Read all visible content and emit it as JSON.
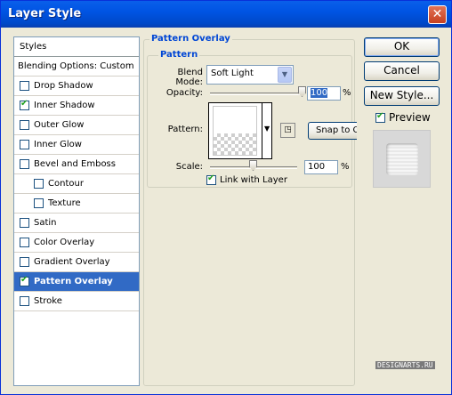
{
  "window": {
    "title": "Layer Style",
    "close_glyph": "✕"
  },
  "styles_list": {
    "header": "Styles",
    "blending_options": "Blending Options: Custom",
    "items": [
      {
        "label": "Drop Shadow",
        "checked": false,
        "indent": false,
        "selected": false
      },
      {
        "label": "Inner Shadow",
        "checked": true,
        "indent": false,
        "selected": false
      },
      {
        "label": "Outer Glow",
        "checked": false,
        "indent": false,
        "selected": false
      },
      {
        "label": "Inner Glow",
        "checked": false,
        "indent": false,
        "selected": false
      },
      {
        "label": "Bevel and Emboss",
        "checked": false,
        "indent": false,
        "selected": false
      },
      {
        "label": "Contour",
        "checked": false,
        "indent": true,
        "selected": false
      },
      {
        "label": "Texture",
        "checked": false,
        "indent": true,
        "selected": false
      },
      {
        "label": "Satin",
        "checked": false,
        "indent": false,
        "selected": false
      },
      {
        "label": "Color Overlay",
        "checked": false,
        "indent": false,
        "selected": false
      },
      {
        "label": "Gradient Overlay",
        "checked": false,
        "indent": false,
        "selected": false
      },
      {
        "label": "Pattern Overlay",
        "checked": true,
        "indent": false,
        "selected": true
      },
      {
        "label": "Stroke",
        "checked": false,
        "indent": false,
        "selected": false
      }
    ]
  },
  "panel": {
    "group_title": "Pattern Overlay",
    "subgroup_title": "Pattern",
    "blend_mode_label": "Blend Mode:",
    "blend_mode_value": "Soft Light",
    "opacity_label": "Opacity:",
    "opacity_value": "100",
    "opacity_unit": "%",
    "opacity_level": 100,
    "pattern_label": "Pattern:",
    "snap_button": "Snap to Origin",
    "scale_label": "Scale:",
    "scale_value": "100",
    "scale_unit": "%",
    "scale_level": 100,
    "link_label": "Link with Layer",
    "link_checked": true
  },
  "buttons": {
    "ok": "OK",
    "cancel": "Cancel",
    "new_style": "New Style...",
    "preview_label": "Preview",
    "preview_checked": true
  },
  "watermark": "DESIGNARTS.RU",
  "colors": {
    "title_bar": "#0054e3",
    "selected_item": "#316ac5",
    "group_title": "#0046d5",
    "check_mark": "#21a121"
  }
}
